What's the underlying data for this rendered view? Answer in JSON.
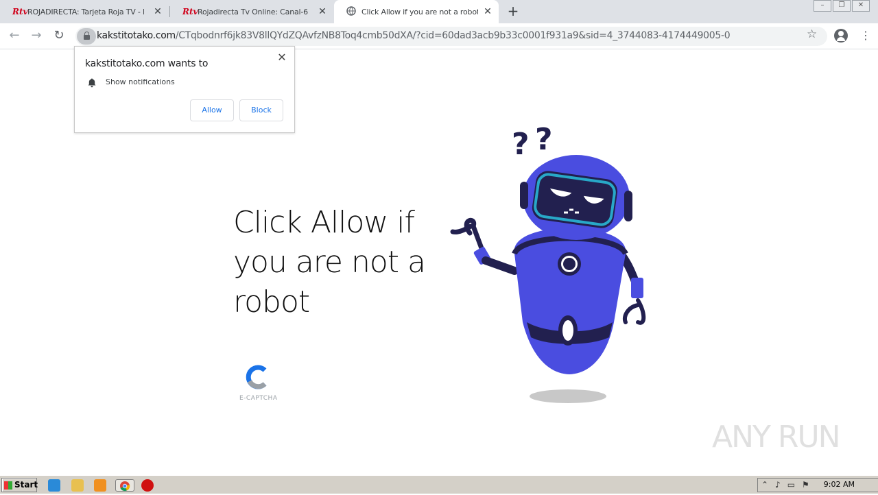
{
  "tabs": [
    {
      "favicon": "Rtv",
      "title": "ROJADIRECTA: Tarjeta Roja TV - Pir",
      "close": "✕"
    },
    {
      "favicon": "Rtv",
      "title": "Rojadirecta Tv Online: Canal-6",
      "close": "✕"
    },
    {
      "favicon": "globe-icon",
      "title": "Click Allow if you are not a robot",
      "close": "✕"
    }
  ],
  "new_tab": "+",
  "address": {
    "host": "kakstitotako.com",
    "path": "/CTqbodnrf6jk83V8llQYdZQAvfzNB8Toq4cmb50dXA/?cid=60dad3acb9b33c0001f931a9&sid=4_3744083-4174449005-0"
  },
  "popup": {
    "title": "kakstitotako.com wants to",
    "permission": "Show notifications",
    "allow": "Allow",
    "block": "Block",
    "close": "✕"
  },
  "page": {
    "headline": "Click Allow if you are not a robot",
    "captcha_label": "E-CAPTCHA"
  },
  "watermark": "ANY RUN",
  "taskbar": {
    "start": "Start",
    "clock": "9:02 AM"
  },
  "colors": {
    "robot_blue": "#4a4de0",
    "robot_dark": "#22204f",
    "visor": "#28a8c8",
    "link_blue": "#1a73e8"
  }
}
